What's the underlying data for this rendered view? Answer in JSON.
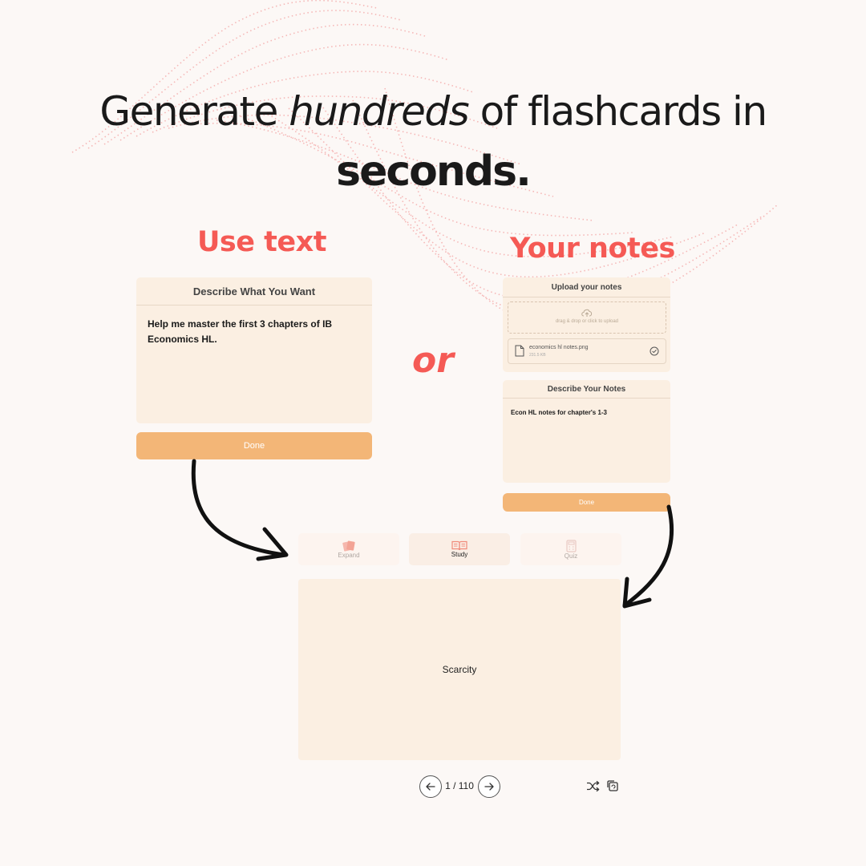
{
  "headline": {
    "line1_before": "Generate ",
    "line1_emphasis": "hundreds",
    "line1_after": " of flashcards in",
    "line2": "seconds."
  },
  "left": {
    "section_title": "Use text",
    "panel_title": "Describe What You Want",
    "prompt_text": "Help me master the first 3 chapters of IB Economics HL.",
    "done_label": "Done"
  },
  "or_label": "or",
  "right": {
    "section_title": "Your notes",
    "upload_title": "Upload your notes",
    "upload_hint": "drag & drop or click to upload",
    "file_name": "economics hl notes.png",
    "file_size": "231.5 KB",
    "describe_title": "Describe Your Notes",
    "describe_text": "Econ HL notes for chapter's 1-3",
    "done_label": "Done"
  },
  "study": {
    "tabs": [
      {
        "label": "Expand",
        "icon": "cards-icon",
        "active": false
      },
      {
        "label": "Study",
        "icon": "book-icon",
        "active": true
      },
      {
        "label": "Quiz",
        "icon": "calculator-icon",
        "active": false
      }
    ],
    "card_text": "Scarcity",
    "counter": "1 / 110",
    "icons": [
      "arrow-left-icon",
      "arrow-right-icon",
      "shuffle-icon",
      "flip-card-icon"
    ]
  },
  "colors": {
    "accent_red": "#f55a55",
    "button_orange": "#f3b677",
    "panel_bg": "#fbefe2",
    "page_bg": "#fcf8f6"
  }
}
